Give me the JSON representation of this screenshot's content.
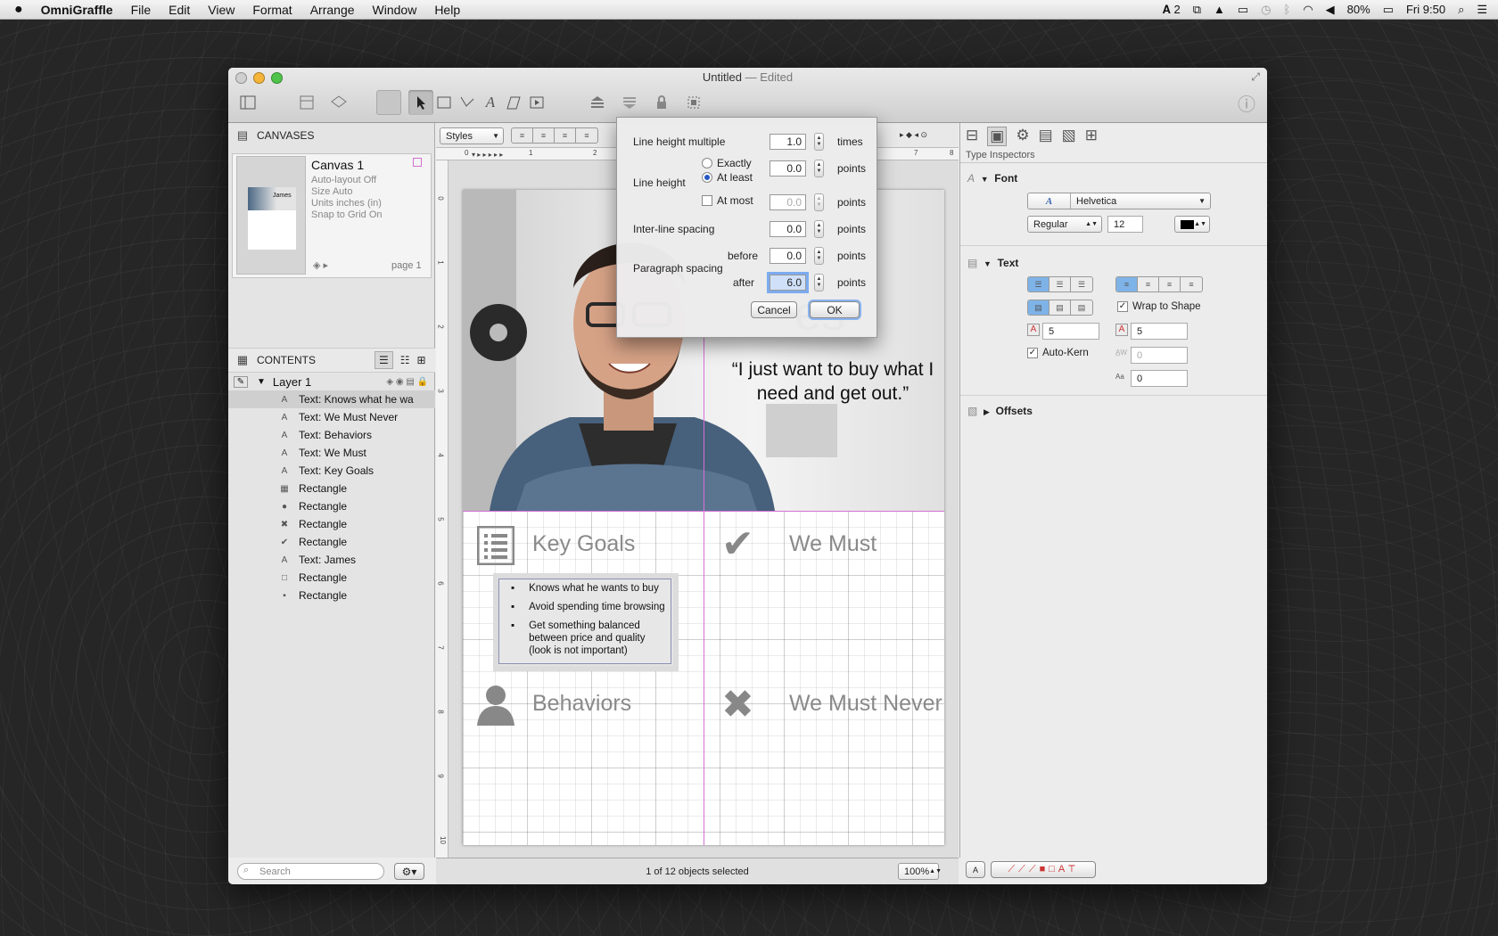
{
  "menubar": {
    "app": "OmniGraffle",
    "items": [
      "File",
      "Edit",
      "View",
      "Format",
      "Arrange",
      "Window",
      "Help"
    ],
    "right": {
      "adobe": "2",
      "battery": "80%",
      "clock": "Fri 9:50"
    }
  },
  "window": {
    "title": "Untitled",
    "edited": "— Edited"
  },
  "left": {
    "canvases_header": "CANVASES",
    "canvas": {
      "name": "Canvas 1",
      "autolayout": "Auto-layout Off",
      "size": "Size Auto",
      "units": "Units inches (in)",
      "snap": "Snap to Grid On",
      "page": "page 1",
      "thumb_text": "James"
    },
    "contents_header": "CONTENTS",
    "layer": "Layer 1",
    "items": [
      {
        "icon": "A",
        "label": "Text: Knows what he wa"
      },
      {
        "icon": "A",
        "label": "Text: We Must Never"
      },
      {
        "icon": "A",
        "label": "Text: Behaviors"
      },
      {
        "icon": "A",
        "label": "Text: We Must"
      },
      {
        "icon": "A",
        "label": "Text: Key Goals"
      },
      {
        "icon": "▦",
        "label": "Rectangle"
      },
      {
        "icon": "●",
        "label": "Rectangle"
      },
      {
        "icon": "✖",
        "label": "Rectangle"
      },
      {
        "icon": "✔",
        "label": "Rectangle"
      },
      {
        "icon": "A",
        "label": "Text: James"
      },
      {
        "icon": "□",
        "label": "Rectangle"
      },
      {
        "icon": "▪",
        "label": "Rectangle"
      }
    ],
    "search_placeholder": "Search"
  },
  "stylebar": {
    "styles": "Styles"
  },
  "canvas": {
    "name_partial": "es",
    "quote": "“I just want to buy what I need and get out.”",
    "key_goals": "Key Goals",
    "we_must": "We Must",
    "behaviors": "Behaviors",
    "we_must_never": "We Must Never",
    "bullets": [
      "Knows what he wants to buy",
      "Avoid spending time browsing",
      "Get something balanced between price and quality (look is not important)"
    ],
    "ruler_top": [
      "0",
      "1",
      "2",
      "7",
      "8"
    ],
    "ruler_left": [
      "0",
      "1",
      "2",
      "3",
      "4",
      "5",
      "6",
      "7",
      "8",
      "9",
      "10"
    ]
  },
  "status": {
    "selection": "1 of 12 objects selected",
    "zoom": "100%"
  },
  "dialog": {
    "line_height_multiple": "Line height multiple",
    "lhm_value": "1.0",
    "times": "times",
    "line_height": "Line height",
    "exactly": "Exactly",
    "at_least": "At least",
    "at_most": "At most",
    "exactly_value": "0.0",
    "at_most_value": "0.0",
    "inter_line": "Inter-line spacing",
    "inter_value": "0.0",
    "paragraph": "Paragraph spacing",
    "before": "before",
    "before_value": "0.0",
    "after": "after",
    "after_value": "6.0",
    "points": "points",
    "cancel": "Cancel",
    "ok": "OK"
  },
  "inspector": {
    "title": "Type Inspectors",
    "font_section": "Font",
    "font_name": "Helvetica",
    "font_style": "Regular",
    "font_size": "12",
    "text_section": "Text",
    "wrap": "Wrap to Shape",
    "margin_left": "5",
    "margin_right": "5",
    "autokern": "Auto-Kern",
    "kern": "0",
    "baseline": "0",
    "offsets_section": "Offsets"
  }
}
